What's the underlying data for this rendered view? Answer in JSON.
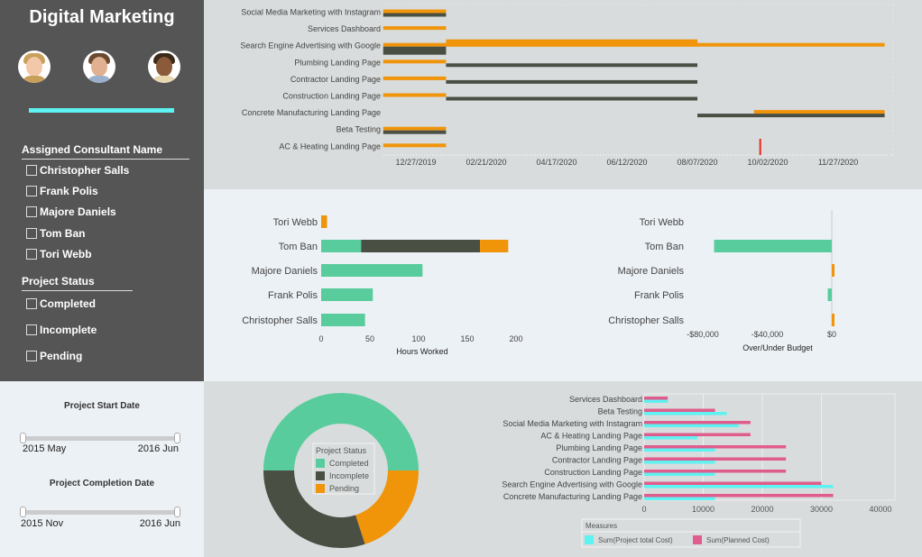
{
  "sidebar": {
    "title": "Digital Marketing",
    "consultant_filter": {
      "title": "Assigned Consultant Name",
      "options": [
        "Christopher Salls",
        "Frank Polis",
        "Majore Daniels",
        "Tom Ban",
        "Tori Webb"
      ]
    },
    "status_filter": {
      "title": "Project Status",
      "options": [
        "Completed",
        "Incomplete",
        "Pending"
      ]
    }
  },
  "date_filters": [
    {
      "title": "Project Start Date",
      "min": "2015 May",
      "max": "2016 Jun"
    },
    {
      "title": "Project Completion Date",
      "min": "2015 Nov",
      "max": "2016 Jun"
    }
  ],
  "colors": {
    "orange": "#f0940a",
    "dark": "#4a4f44",
    "green": "#58cc9c",
    "cyan": "#5ef2f2",
    "pink": "#e05c8c",
    "sidebar": "#555555"
  },
  "chart_data": [
    {
      "type": "gantt",
      "x_ticks": [
        "12/27/2019",
        "02/21/2020",
        "04/17/2020",
        "06/12/2020",
        "08/07/2020",
        "10/02/2020",
        "11/27/2020"
      ],
      "marker_date": "09/26/2020",
      "tasks": [
        {
          "name": "Social Media Marketing with Instagram",
          "orange_bars": [
            [
              "12/01/2019",
              "01/20/2020"
            ]
          ],
          "dark_bars": [
            [
              "12/01/2019",
              "01/20/2020"
            ]
          ]
        },
        {
          "name": "Services Dashboard",
          "orange_bars": [
            [
              "12/01/2019",
              "01/20/2020"
            ]
          ],
          "dark_bars": []
        },
        {
          "name": "Search Engine Advertising with Google",
          "orange_bars": [
            [
              "12/01/2019",
              "01/03/2021"
            ],
            [
              "01/20/2020",
              "08/07/2020"
            ]
          ],
          "dark_bars": [
            [
              "12/01/2019",
              "01/20/2020"
            ]
          ]
        },
        {
          "name": "Plumbing Landing Page",
          "orange_bars": [
            [
              "12/01/2019",
              "01/20/2020"
            ]
          ],
          "dark_bars": [
            [
              "01/20/2020",
              "08/07/2020"
            ]
          ]
        },
        {
          "name": "Contractor Landing Page",
          "orange_bars": [
            [
              "12/01/2019",
              "01/20/2020"
            ]
          ],
          "dark_bars": [
            [
              "01/20/2020",
              "08/07/2020"
            ]
          ]
        },
        {
          "name": "Construction Landing Page",
          "orange_bars": [
            [
              "12/01/2019",
              "01/20/2020"
            ]
          ],
          "dark_bars": [
            [
              "01/20/2020",
              "08/07/2020"
            ]
          ]
        },
        {
          "name": "Concrete Manufacturing Landing Page",
          "orange_bars": [
            [
              "09/21/2020",
              "01/03/2021"
            ]
          ],
          "dark_bars": [
            [
              "08/07/2020",
              "01/03/2021"
            ]
          ]
        },
        {
          "name": "Beta Testing",
          "orange_bars": [
            [
              "12/01/2019",
              "01/20/2020"
            ]
          ],
          "dark_bars": [
            [
              "12/01/2019",
              "01/20/2020"
            ]
          ]
        },
        {
          "name": "AC & Heating Landing Page",
          "orange_bars": [
            [
              "12/01/2019",
              "01/20/2020"
            ]
          ],
          "dark_bars": []
        }
      ]
    },
    {
      "type": "bar",
      "stacked": true,
      "orientation": "horizontal",
      "xlabel": "Hours Worked",
      "xlim": [
        0,
        200
      ],
      "x_ticks": [
        "0",
        "50",
        "100",
        "150",
        "200"
      ],
      "categories": [
        "Tori Webb",
        "Tom Ban",
        "Majore Daniels",
        "Frank Polis",
        "Christopher Salls"
      ],
      "series": [
        {
          "color": "#58cc9c",
          "values": [
            0,
            41,
            104,
            53,
            45
          ]
        },
        {
          "color": "#4a4f44",
          "values": [
            0,
            122,
            0,
            0,
            0
          ]
        },
        {
          "color": "#f0940a",
          "values": [
            6,
            29,
            0,
            0,
            0
          ]
        }
      ]
    },
    {
      "type": "bar",
      "orientation": "horizontal",
      "xlabel": "Over/Under Budget",
      "xlim": [
        -85000,
        0
      ],
      "x_ticks": [
        {
          "value": -80000,
          "label": "-$80,000"
        },
        {
          "value": -40000,
          "label": "-$40,000"
        },
        {
          "value": 0,
          "label": "$0"
        }
      ],
      "categories": [
        "Tori Webb",
        "Tom Ban",
        "Majore Daniels",
        "Frank Polis",
        "Christopher Salls"
      ],
      "values": [
        0,
        -73000,
        1500,
        -2500,
        1500
      ]
    },
    {
      "type": "pie",
      "donut": true,
      "legend_title": "Project Status",
      "legend_position": "center",
      "slices": [
        {
          "label": "Completed",
          "value": 50,
          "color": "#58cc9c"
        },
        {
          "label": "Pending",
          "value": 20,
          "color": "#f0940a"
        },
        {
          "label": "Incomplete",
          "value": 30,
          "color": "#4a4f44"
        }
      ],
      "legend_order": [
        "Completed",
        "Incomplete",
        "Pending"
      ]
    },
    {
      "type": "bar",
      "orientation": "horizontal",
      "xlim": [
        0,
        40000
      ],
      "x_ticks": [
        "0",
        "10000",
        "20000",
        "30000",
        "40000"
      ],
      "grid": true,
      "legend_title": "Measures",
      "legend_position": "bottom",
      "categories": [
        "Services Dashboard",
        "Beta Testing",
        "Social Media Marketing with Instagram",
        "AC & Heating Landing Page",
        "Plumbing Landing Page",
        "Contractor Landing Page",
        "Construction Landing Page",
        "Search Engine Advertising with Google",
        "Concrete Manufacturing Landing Page"
      ],
      "series": [
        {
          "name": "Sum(Planned Cost)",
          "color": "#e05c8c",
          "values": [
            4000,
            12000,
            18000,
            18000,
            24000,
            24000,
            24000,
            30000,
            32000
          ]
        },
        {
          "name": "Sum(Project total  Cost)",
          "color": "#5ef2f2",
          "values": [
            4000,
            14000,
            16000,
            9000,
            12000,
            12000,
            12000,
            32000,
            12000
          ]
        }
      ]
    }
  ]
}
